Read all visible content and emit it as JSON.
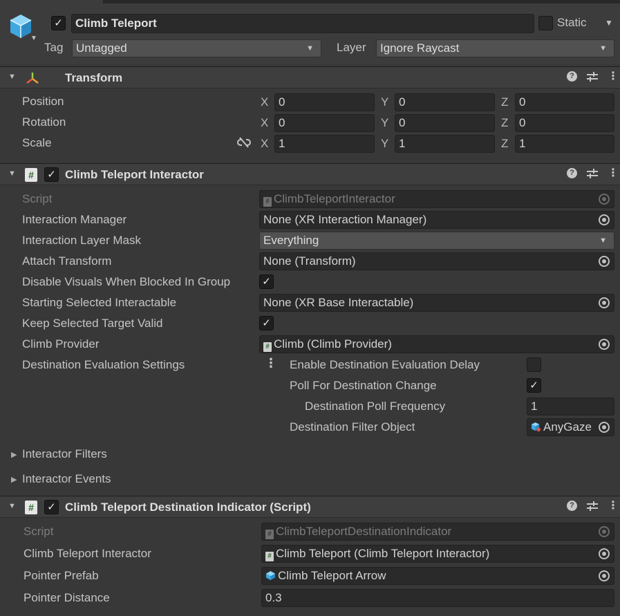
{
  "header": {
    "object_name": "Climb Teleport",
    "active": true,
    "static_label": "Static",
    "tag_label": "Tag",
    "tag_value": "Untagged",
    "layer_label": "Layer",
    "layer_value": "Ignore Raycast"
  },
  "transform": {
    "title": "Transform",
    "rows": [
      {
        "label": "Position",
        "x": "0",
        "y": "0",
        "z": "0"
      },
      {
        "label": "Rotation",
        "x": "0",
        "y": "0",
        "z": "0"
      },
      {
        "label": "Scale",
        "x": "1",
        "y": "1",
        "z": "1"
      }
    ],
    "axes": [
      "X",
      "Y",
      "Z"
    ]
  },
  "interactor": {
    "title": "Climb Teleport Interactor",
    "script_label": "Script",
    "script_value": "ClimbTeleportInteractor",
    "interaction_manager_label": "Interaction Manager",
    "interaction_manager_value": "None (XR Interaction Manager)",
    "layer_mask_label": "Interaction Layer Mask",
    "layer_mask_value": "Everything",
    "attach_transform_label": "Attach Transform",
    "attach_transform_value": "None (Transform)",
    "disable_visuals_label": "Disable Visuals When Blocked In Group",
    "starting_selected_label": "Starting Selected Interactable",
    "starting_selected_value": "None (XR Base Interactable)",
    "keep_selected_label": "Keep Selected Target Valid",
    "climb_provider_label": "Climb Provider",
    "climb_provider_value": "Climb (Climb Provider)",
    "dest_eval_label": "Destination Evaluation Settings",
    "enable_delay_label": "Enable Destination Evaluation Delay",
    "poll_change_label": "Poll For Destination Change",
    "poll_frequency_label": "Destination Poll Frequency",
    "poll_frequency_value": "1",
    "filter_object_label": "Destination Filter Object",
    "filter_object_value": "AnyGaze",
    "interactor_filters_label": "Interactor Filters",
    "interactor_events_label": "Interactor Events"
  },
  "indicator": {
    "title": "Climb Teleport Destination Indicator (Script)",
    "script_label": "Script",
    "script_value": "ClimbTeleportDestinationIndicator",
    "interactor_label": "Climb Teleport Interactor",
    "interactor_value": "Climb Teleport (Climb Teleport Interactor)",
    "pointer_prefab_label": "Pointer Prefab",
    "pointer_prefab_value": "Climb Teleport Arrow",
    "pointer_distance_label": "Pointer Distance",
    "pointer_distance_value": "0.3"
  },
  "icons": {
    "gameobject": "cube-icon",
    "help": "help-icon",
    "presets": "presets-icon",
    "menu": "kebab-menu-icon",
    "object_picker": "object-picker-icon",
    "unlink": "unlinked-scale-icon"
  },
  "colors": {
    "background": "#383838",
    "field": "#2a2a2a",
    "cube_blue": "#4fb3e8"
  }
}
